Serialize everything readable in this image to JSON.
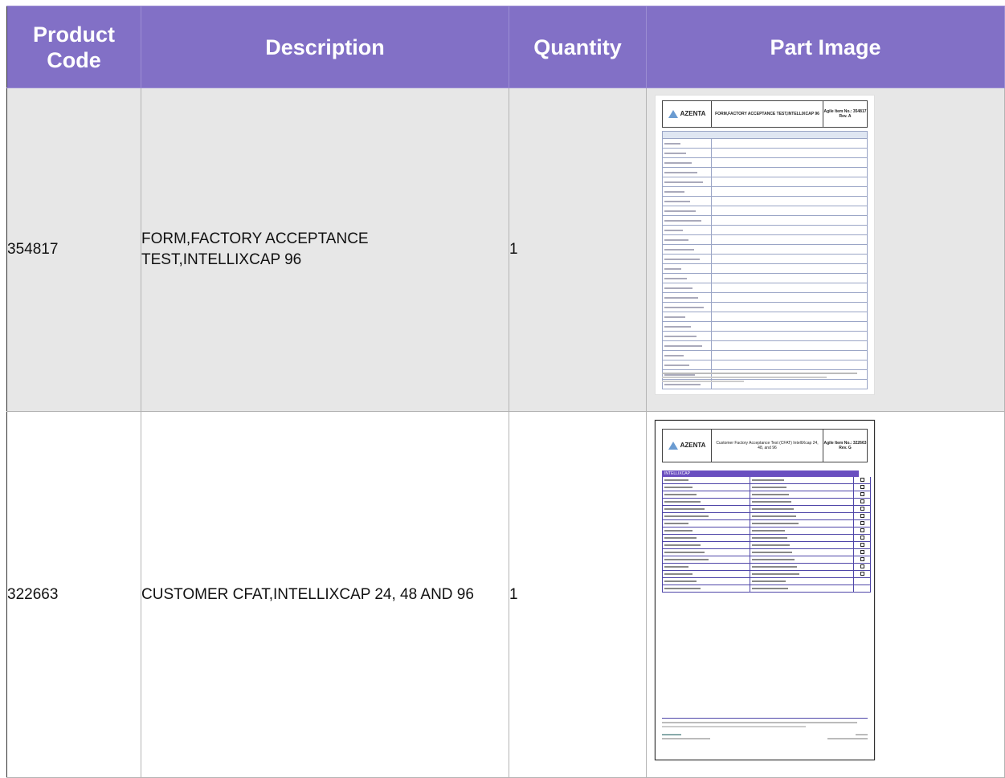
{
  "table": {
    "headers": {
      "code": "Product Code",
      "desc": "Description",
      "qty": "Quantity",
      "image": "Part Image"
    },
    "rows": [
      {
        "code": "354817",
        "desc": "FORM,FACTORY ACCEPTANCE TEST,INTELLIXCAP 96",
        "qty": "1",
        "doc": {
          "logo": "AZENTA",
          "title": "FORM,FACTORY ACCEPTANCE TEST,INTELLIXCAP 96",
          "agile": "Agile Item No.: 354817 Rev. A"
        }
      },
      {
        "code": "322663",
        "desc": "CUSTOMER CFAT,INTELLIXCAP 24, 48 AND 96",
        "qty": "1",
        "doc": {
          "logo": "AZENTA",
          "title": "Customer Factory Acceptance Test (CFAT) IntelliXcap 24, 48, and 96",
          "agile": "Agile Item No.: 322663 Rev. G",
          "section": "INTELLIXCAP"
        }
      }
    ]
  },
  "colors": {
    "header_bg": "#8270c6",
    "row_alt_bg": "#e7e7e7",
    "doc_accent": "#4e45a8"
  }
}
